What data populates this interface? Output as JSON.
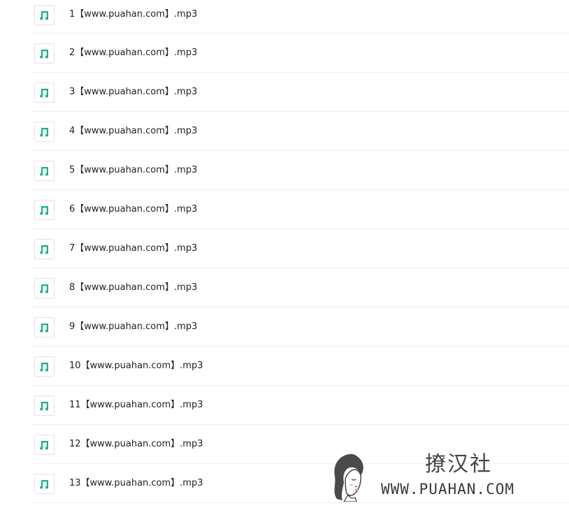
{
  "files": [
    {
      "name": "1【www.puahan.com】.mp3",
      "icon": "music-note-icon"
    },
    {
      "name": "2【www.puahan.com】.mp3",
      "icon": "music-note-icon"
    },
    {
      "name": "3【www.puahan.com】.mp3",
      "icon": "music-note-icon"
    },
    {
      "name": "4【www.puahan.com】.mp3",
      "icon": "music-note-icon"
    },
    {
      "name": "5【www.puahan.com】.mp3",
      "icon": "music-note-icon"
    },
    {
      "name": "6【www.puahan.com】.mp3",
      "icon": "music-note-icon"
    },
    {
      "name": "7【www.puahan.com】.mp3",
      "icon": "music-note-icon"
    },
    {
      "name": "8【www.puahan.com】.mp3",
      "icon": "music-note-icon"
    },
    {
      "name": "9【www.puahan.com】.mp3",
      "icon": "music-note-icon"
    },
    {
      "name": "10【www.puahan.com】.mp3",
      "icon": "music-note-icon"
    },
    {
      "name": "11【www.puahan.com】.mp3",
      "icon": "music-note-icon"
    },
    {
      "name": "12【www.puahan.com】.mp3",
      "icon": "music-note-icon"
    },
    {
      "name": "13【www.puahan.com】.mp3",
      "icon": "music-note-icon"
    }
  ],
  "watermark": {
    "brand_cn": "撩汉社",
    "brand_url": "WWW.PUAHAN.COM"
  },
  "colors": {
    "icon_accent": "#16b28b",
    "row_divider": "#eeeeee",
    "text": "#222222"
  }
}
